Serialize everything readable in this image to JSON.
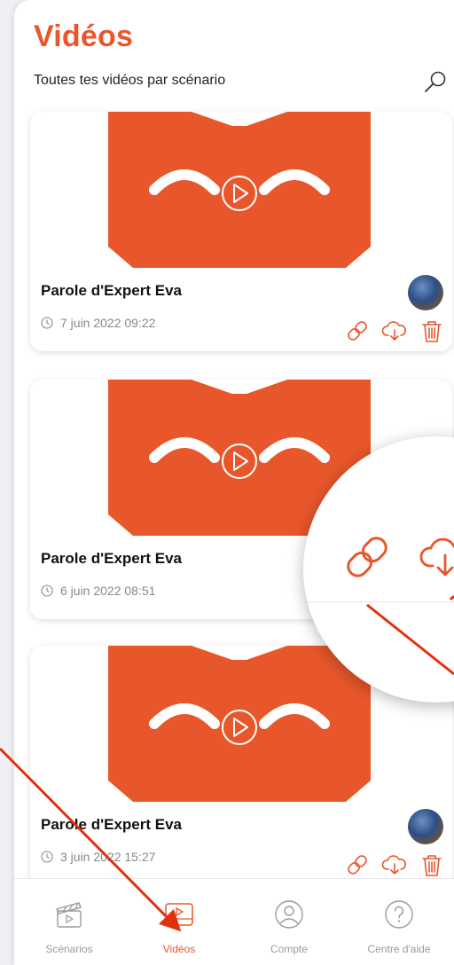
{
  "header": {
    "title": "Vidéos",
    "subtitle": "Toutes tes vidéos par scénario"
  },
  "videos": [
    {
      "title": "Parole d'Expert Eva",
      "date": "7 juin 2022 09:22"
    },
    {
      "title": "Parole d'Expert Eva",
      "date": "6 juin 2022 08:51"
    },
    {
      "title": "Parole d'Expert Eva",
      "date": "3 juin 2022 15:27"
    }
  ],
  "nav": [
    {
      "label": "Scénarios",
      "icon": "clapperboard-icon"
    },
    {
      "label": "Vidéos",
      "icon": "video-player-icon"
    },
    {
      "label": "Compte",
      "icon": "user-circle-icon"
    },
    {
      "label": "Centre d'aide",
      "icon": "help-circle-icon"
    }
  ],
  "colors": {
    "accent": "#e8572b",
    "text": "#111111",
    "muted": "#888888"
  }
}
